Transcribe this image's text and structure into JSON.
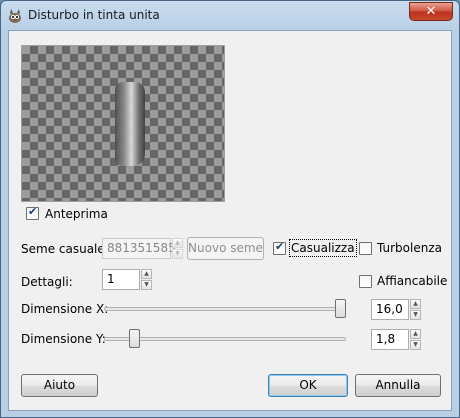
{
  "window": {
    "title": "Disturbo in tinta unita",
    "close_label": "✕"
  },
  "preview": {
    "checkbox_label": "Anteprima",
    "checked": true
  },
  "seed": {
    "label": "Seme casuale:",
    "value": "881351585",
    "new_seed_label": "Nuovo seme",
    "randomize_label": "Casualizza",
    "randomize_checked": true
  },
  "turbulence": {
    "label": "Turbolenza",
    "checked": false
  },
  "detail": {
    "label": "Dettagli:",
    "value": "1"
  },
  "tileable": {
    "label": "Affiancabile",
    "checked": false
  },
  "size_x": {
    "label": "Dimensione X:",
    "value": "16,0",
    "level": 1.0
  },
  "size_y": {
    "label": "Dimensione Y:",
    "value": "1,8",
    "level": 0.11
  },
  "buttons": {
    "help": "Aiuto",
    "ok": "OK",
    "cancel": "Annulla"
  }
}
